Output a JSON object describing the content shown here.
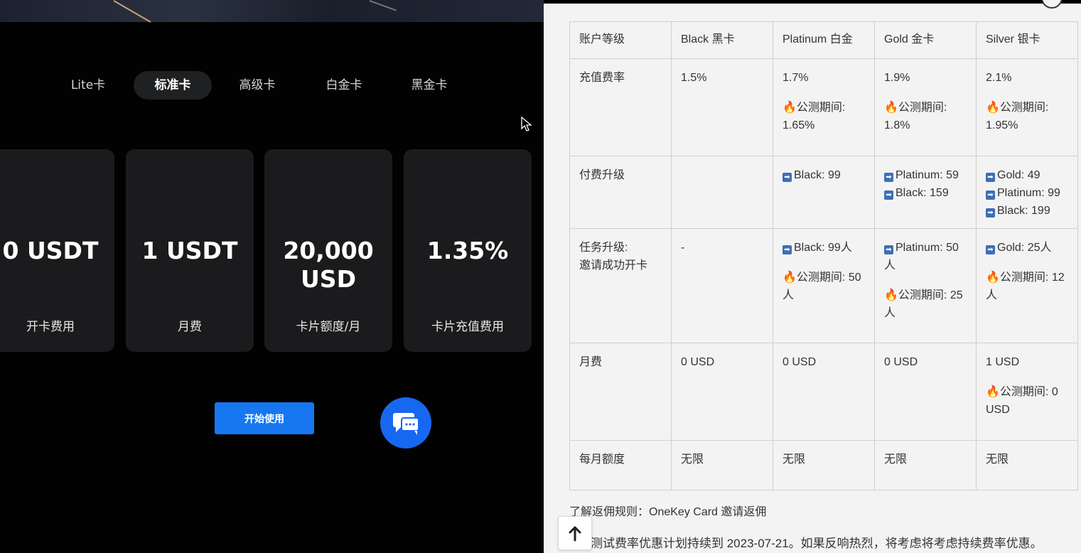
{
  "left": {
    "tabs": [
      "Lite卡",
      "标准卡",
      "高级卡",
      "白金卡",
      "黑金卡"
    ],
    "active_tab": "标准卡",
    "cards": [
      {
        "value": "0 USDT",
        "label": "开卡费用"
      },
      {
        "value": "1 USDT",
        "label": "月费"
      },
      {
        "value_line1": "20,000",
        "value_line2": "USD",
        "label": "卡片额度/月"
      },
      {
        "value": "1.35%",
        "label": "卡片充值费用"
      }
    ],
    "start_button": "开始使用",
    "icons": {
      "chat": "chat-bubbles-icon",
      "cursor": "mouse-pointer-icon"
    },
    "colors": {
      "accent": "#1677f0",
      "card_bg": "#1b1b1d"
    }
  },
  "right": {
    "table": {
      "header": [
        "账户等级",
        "Black 黑卡",
        "Platinum 白金",
        "Gold 金卡",
        "Silver 银卡"
      ],
      "rows": {
        "fee_rate": {
          "label": "充值费率",
          "black": "1.5%",
          "platinum": "1.7%",
          "platinum_promo_1": "🔥公测期间:",
          "platinum_promo_2": "1.65%",
          "gold": "1.9%",
          "gold_promo_1": "🔥公测期间:",
          "gold_promo_2": "1.8%",
          "silver": "2.1%",
          "silver_promo_1": "🔥公测期间:",
          "silver_promo_2": "1.95%"
        },
        "paid_upgrade": {
          "label": "付费升级",
          "black": "",
          "platinum": [
            "Black: 99"
          ],
          "gold": [
            "Platinum: 59",
            "Black: 159"
          ],
          "silver": [
            "Gold: 49",
            "Platinum: 99",
            "Black: 199"
          ]
        },
        "task_upgrade": {
          "label_1": "任务升级:",
          "label_2": "邀请成功开卡",
          "black": "-",
          "platinum": "Black: 99人",
          "platinum_promo_1": "🔥公测期间: 50",
          "platinum_promo_2": "人",
          "gold_1": "Platinum: 50",
          "gold_2": "人",
          "gold_promo_1": "🔥公测期间: 25",
          "gold_promo_2": "人",
          "silver": "Gold: 25人",
          "silver_promo_1": "🔥公测期间: 12",
          "silver_promo_2": "人"
        },
        "monthly_fee": {
          "label": "月费",
          "black": "0 USD",
          "platinum": "0 USD",
          "gold": "0 USD",
          "silver": "1 USD",
          "silver_promo_1": "🔥公测期间: 0",
          "silver_promo_2": "USD"
        },
        "monthly_limit": {
          "label": "每月额度",
          "black": "无限",
          "platinum": "无限",
          "gold": "无限",
          "silver": "无限"
        }
      },
      "arrow_icon": "➡"
    },
    "rebate_note": "了解返佣规则：OneKey Card 邀请返佣",
    "bottom_note": "测试费率优惠计划持续到 2023-07-21。如果反响热烈，将考虑将考虑持续费率优惠。",
    "icons": {
      "scroll_top": "arrow-up-icon",
      "arrow": "right-arrow-box-icon"
    }
  }
}
